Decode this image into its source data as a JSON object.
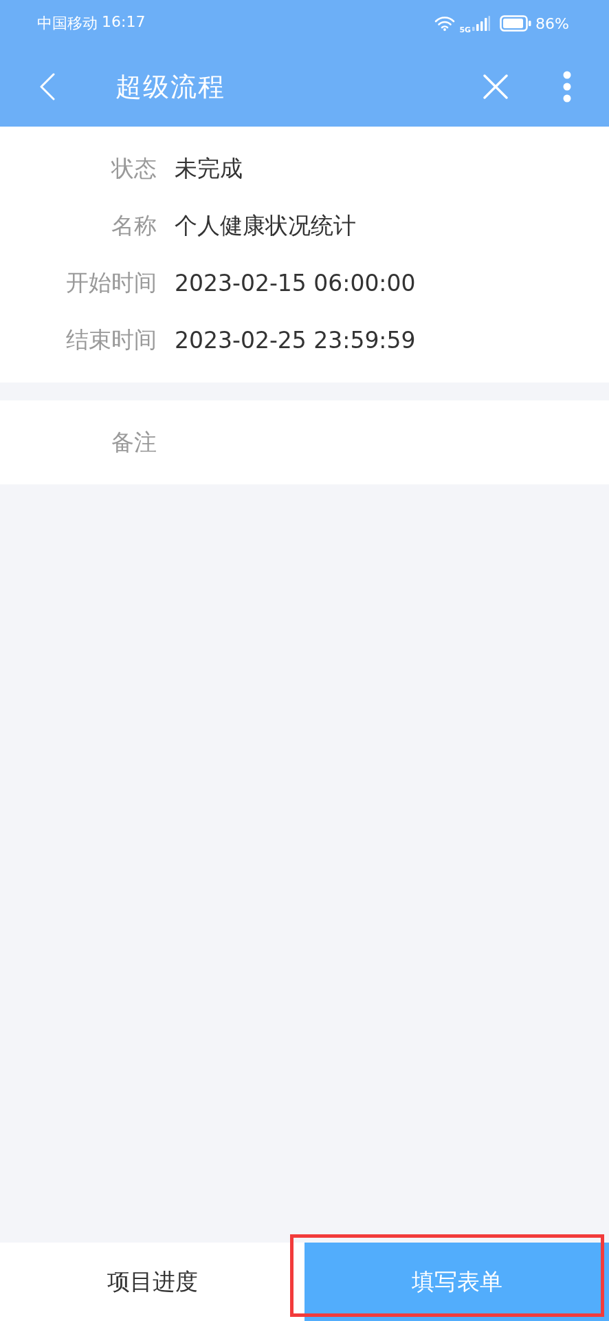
{
  "status_bar": {
    "carrier": "中国移动",
    "time": "16:17",
    "network": "5G",
    "battery": "86%"
  },
  "header": {
    "title": "超级流程"
  },
  "details": [
    {
      "label": "状态",
      "value": "未完成"
    },
    {
      "label": "名称",
      "value": "个人健康状况统计"
    },
    {
      "label": "开始时间",
      "value": "2023-02-15 06:00:00"
    },
    {
      "label": "结束时间",
      "value": "2023-02-25 23:59:59"
    }
  ],
  "remark": {
    "label": "备注"
  },
  "bottom_buttons": [
    {
      "label": "项目进度",
      "kind": "plain",
      "highlighted": false
    },
    {
      "label": "填写表单",
      "kind": "primary",
      "highlighted": true
    }
  ]
}
